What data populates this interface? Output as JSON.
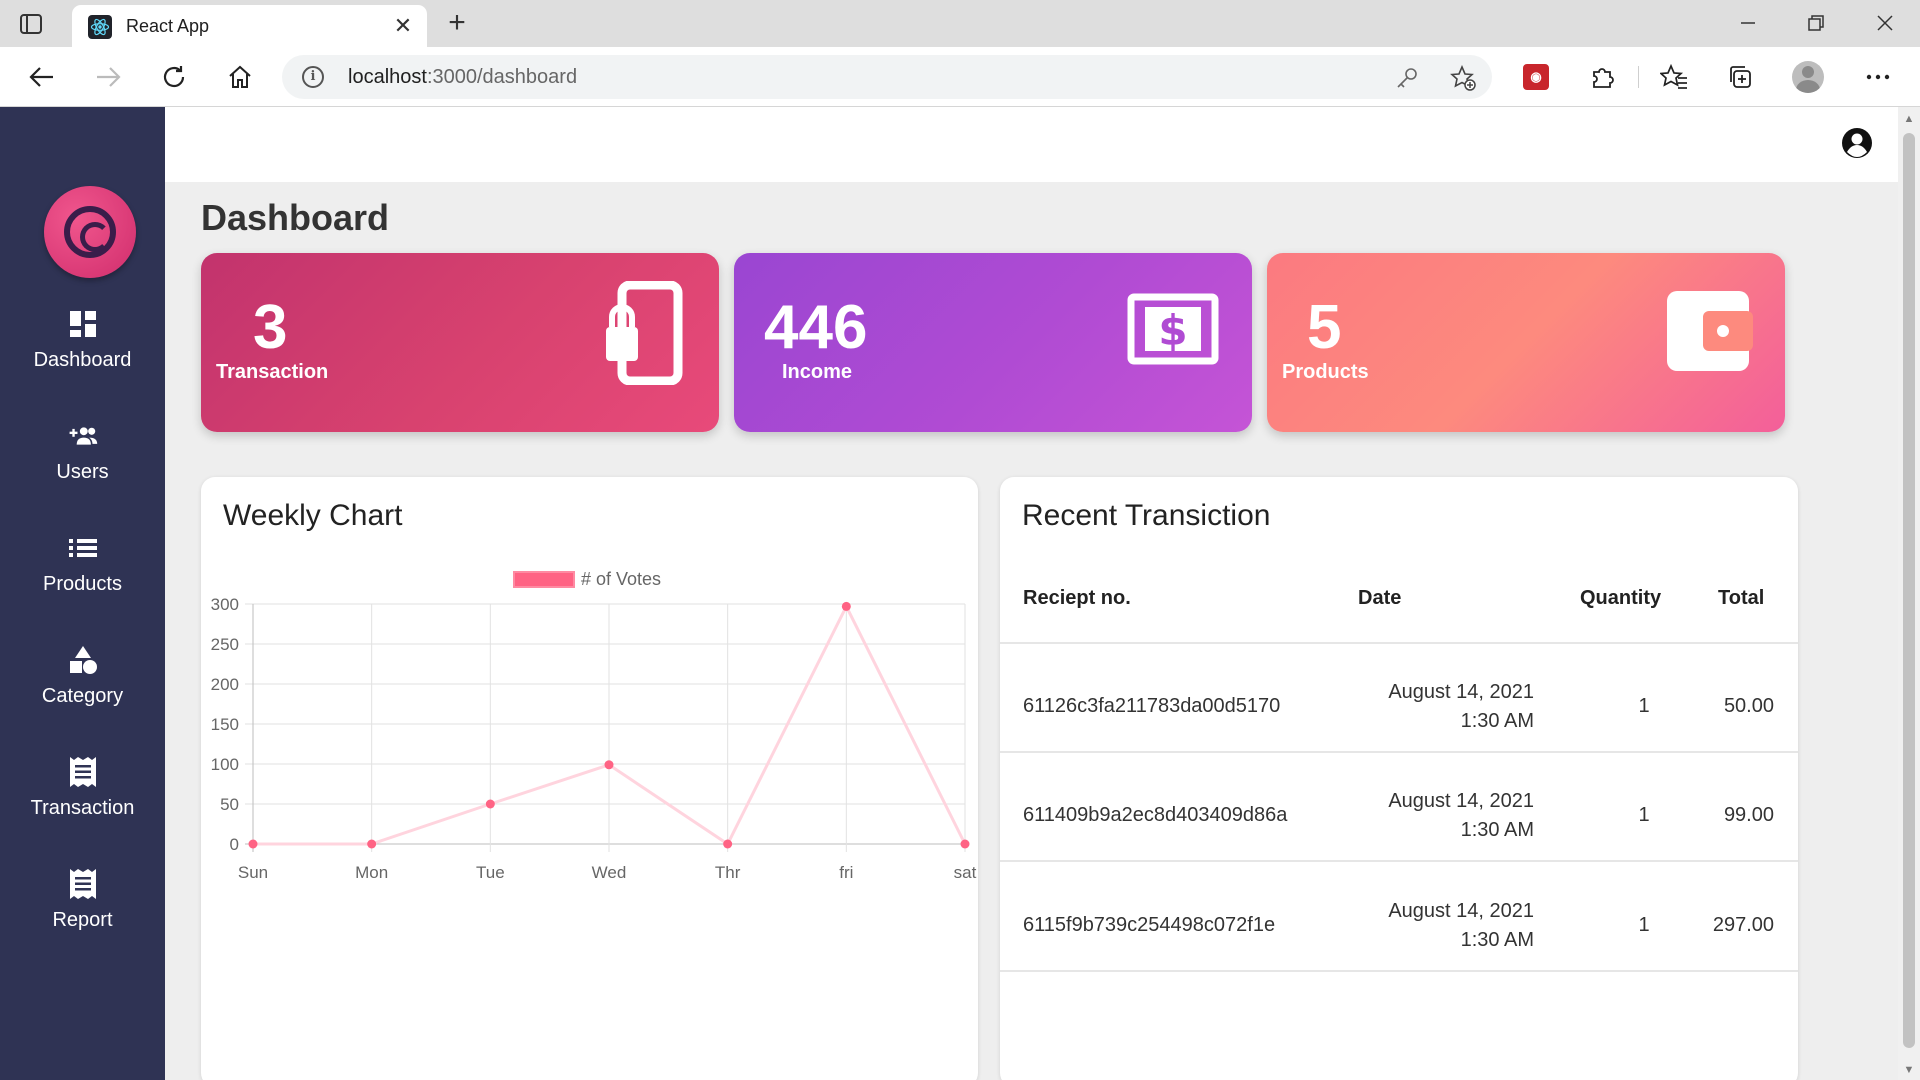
{
  "browser": {
    "tab_title": "React App",
    "url_host": "localhost",
    "url_path": ":3000/dashboard"
  },
  "sidebar": {
    "items": [
      {
        "label": "Dashboard",
        "icon": "dashboard-icon"
      },
      {
        "label": "Users",
        "icon": "group-add-icon"
      },
      {
        "label": "Products",
        "icon": "list-icon"
      },
      {
        "label": "Category",
        "icon": "category-icon"
      },
      {
        "label": "Transaction",
        "icon": "receipt-icon"
      },
      {
        "label": "Report",
        "icon": "receipt-icon"
      }
    ]
  },
  "page": {
    "title": "Dashboard"
  },
  "cards": [
    {
      "value": "3",
      "label": "Transaction",
      "icon": "phone-lock-icon"
    },
    {
      "value": "446",
      "label": "Income",
      "icon": "dollar-bill-icon"
    },
    {
      "value": "5",
      "label": "Products",
      "icon": "wallet-icon"
    }
  ],
  "weekly_chart": {
    "title": "Weekly Chart"
  },
  "chart_data": {
    "type": "line",
    "categories": [
      "Sun",
      "Mon",
      "Tue",
      "Wed",
      "Thr",
      "fri",
      "sat"
    ],
    "series": [
      {
        "name": "# of Votes",
        "values": [
          0,
          0,
          50,
          99,
          0,
          297,
          0
        ]
      }
    ],
    "ylim": [
      0,
      300
    ],
    "yticks": [
      0,
      50,
      100,
      150,
      200,
      250,
      300
    ],
    "grid": true,
    "legend": "top-center",
    "colors": {
      "line": "#ffd4de",
      "point": "#ff6384"
    }
  },
  "recent": {
    "title": "Recent Transiction",
    "headers": {
      "receipt": "Reciept no.",
      "date": "Date",
      "quantity": "Quantity",
      "total": "Total"
    },
    "rows": [
      {
        "receipt": "61126c3fa211783da00d5170",
        "date": "August 14, 2021",
        "time": "1:30 AM",
        "quantity": "1",
        "total": "50.00"
      },
      {
        "receipt": "611409b9a2ec8d403409d86a",
        "date": "August 14, 2021",
        "time": "1:30 AM",
        "quantity": "1",
        "total": "99.00"
      },
      {
        "receipt": "6115f9b739c254498c072f1e",
        "date": "August 14, 2021",
        "time": "1:30 AM",
        "quantity": "1",
        "total": "297.00"
      }
    ]
  }
}
